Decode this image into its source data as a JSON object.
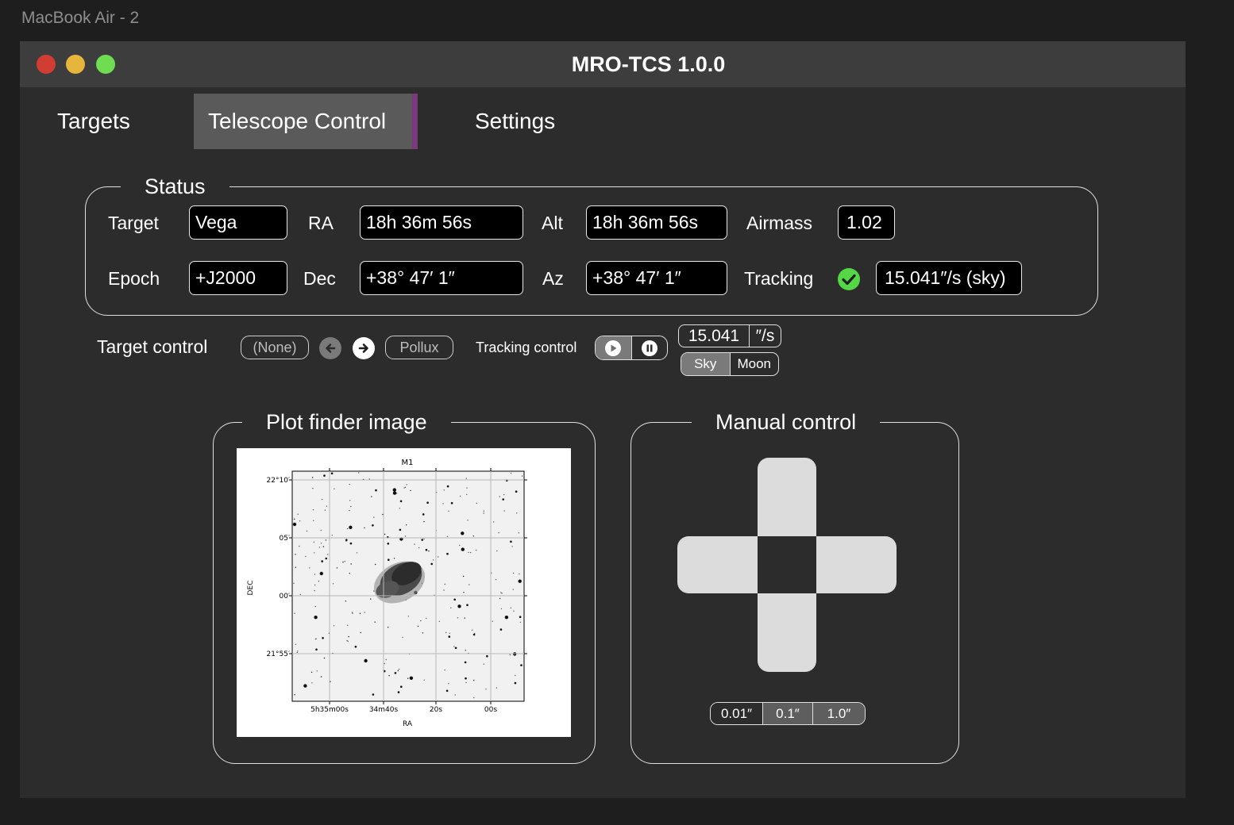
{
  "frame_label": "MacBook Air - 2",
  "window": {
    "title": "MRO-TCS 1.0.0"
  },
  "tabs": [
    {
      "label": "Targets"
    },
    {
      "label": "Telescope Control",
      "active": true
    },
    {
      "label": "Settings"
    }
  ],
  "status": {
    "title": "Status",
    "target_label": "Target",
    "target_value": "Vega",
    "epoch_label": "Epoch",
    "epoch_value": "+J2000",
    "ra_label": "RA",
    "ra_value": "18h 36m 56s",
    "dec_label": "Dec",
    "dec_value": "+38° 47′ 1″",
    "alt_label": "Alt",
    "alt_value": "18h 36m 56s",
    "az_label": "Az",
    "az_value": "+38° 47′ 1″",
    "airmass_label": "Airmass",
    "airmass_value": "1.02",
    "tracking_label": "Tracking",
    "tracking_icon": "check-circle-icon",
    "tracking_ok_color": "#53d744",
    "tracking_rate": "15.041″/s (sky)"
  },
  "target_control": {
    "label": "Target control",
    "prev_target": "(None)",
    "next_target": "Pollux"
  },
  "tracking_control": {
    "label": "Tracking control",
    "rate_value": "15.041",
    "rate_unit": "″/s",
    "sky_label": "Sky",
    "moon_label": "Moon",
    "selected_mode": "Sky"
  },
  "finder": {
    "title": "Plot finder image",
    "plot_title": "M1",
    "xlabel": "RA",
    "ylabel": "DEC",
    "x_ticks": [
      "5h35m00s",
      "34m40s",
      "20s",
      "00s"
    ],
    "y_ticks": [
      "22°10′",
      "05′",
      "00′",
      "21°55′"
    ]
  },
  "manual_control": {
    "title": "Manual control",
    "steps": [
      "0.01″",
      "0.1″",
      "1.0″"
    ],
    "selected_step": "0.01″"
  },
  "colors": {
    "accent_tab": "#7b3a7d",
    "window_bg": "#2c2c2c",
    "titlebar_bg": "#3d3d3d"
  }
}
